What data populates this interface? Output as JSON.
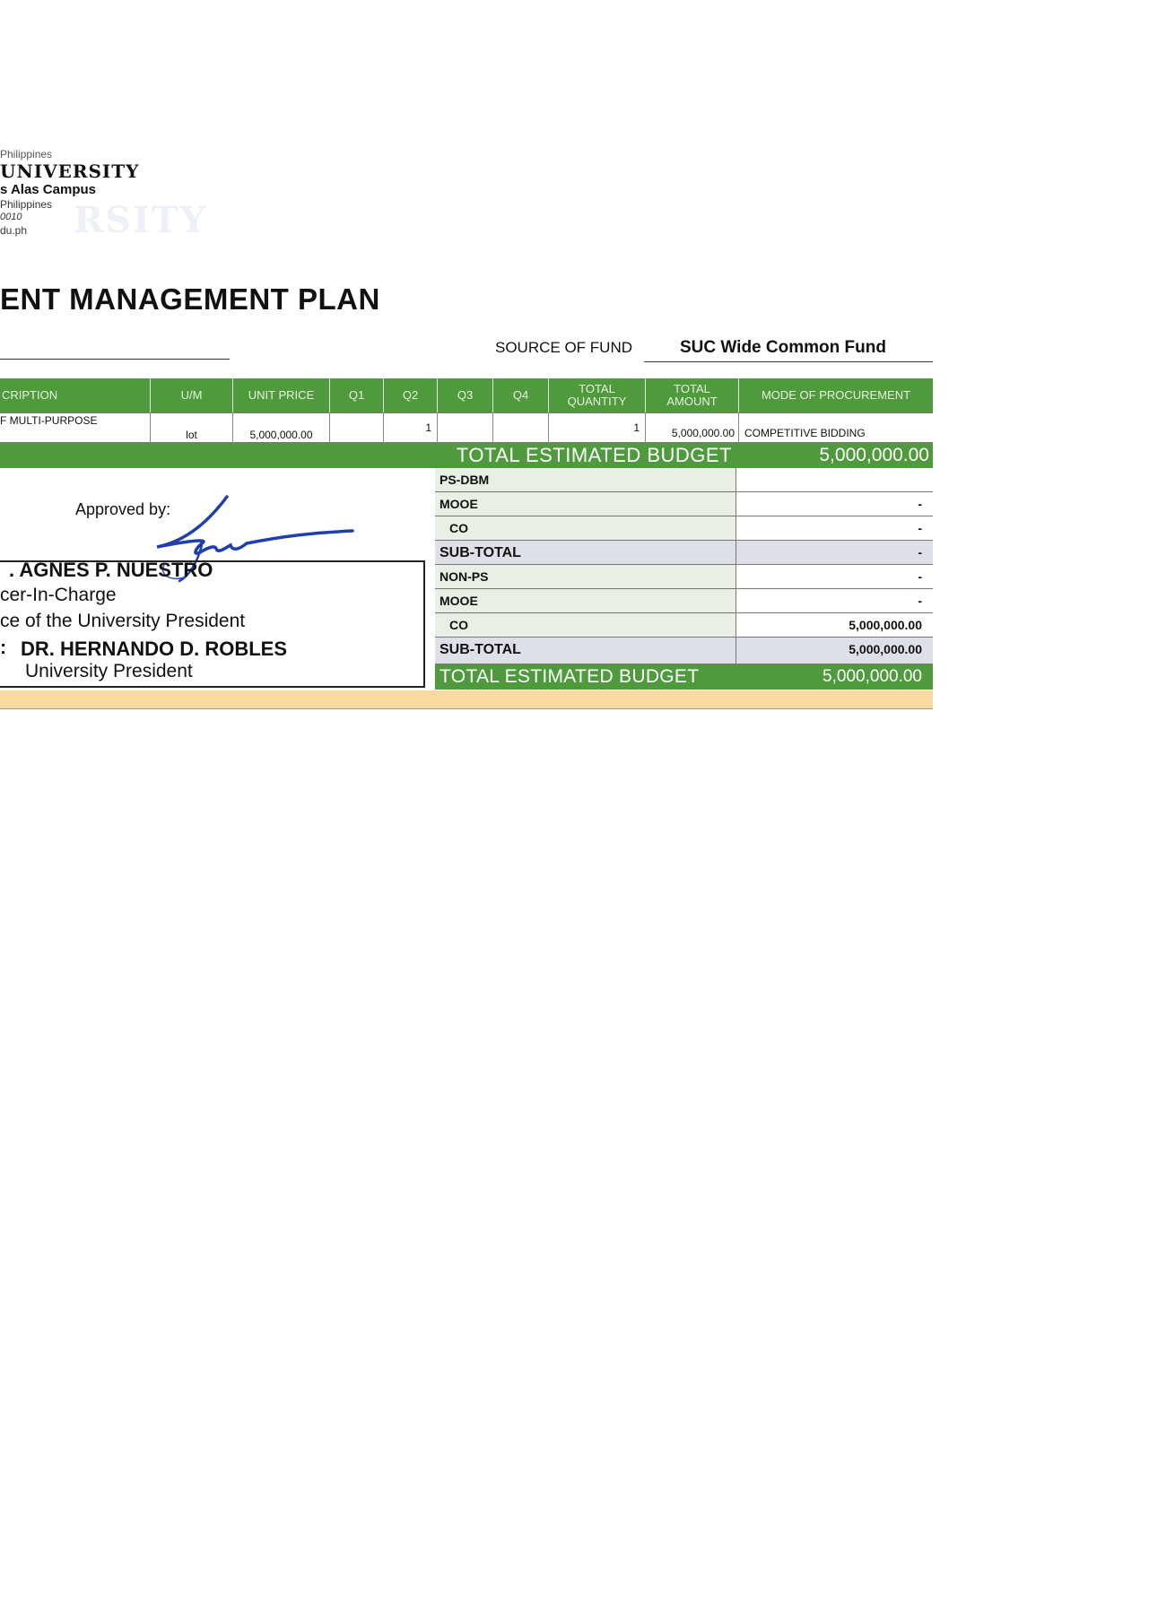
{
  "letterhead": {
    "line1": "Philippines",
    "university": "UNIVERSITY",
    "campus": "s Alas Campus",
    "country": "Philippines",
    "zip": "0010",
    "web": "du.ph",
    "watermark": "RSITY"
  },
  "title": "ENT MANAGEMENT PLAN",
  "source_of_fund": {
    "label": "SOURCE OF FUND",
    "value": "SUC Wide Common Fund"
  },
  "table": {
    "headers": {
      "description": "CRIPTION",
      "um": "U/M",
      "unit_price": "UNIT PRICE",
      "q1": "Q1",
      "q2": "Q2",
      "q3": "Q3",
      "q4": "Q4",
      "total_quantity": "TOTAL QUANTITY",
      "total_amount": "TOTAL AMOUNT",
      "mode": "MODE OF PROCUREMENT"
    },
    "row": {
      "description": "F MULTI-PURPOSE",
      "um": "lot",
      "unit_price": "5,000,000.00",
      "q1": "",
      "q2": "1",
      "q3": "",
      "q4": "",
      "total_quantity": "1",
      "total_amount": "5,000,000.00",
      "mode": "COMPETITIVE BIDDING"
    },
    "total_label": "TOTAL ESTIMATED BUDGET",
    "total_value": "5,000,000.00"
  },
  "summary": {
    "ps_dbm": {
      "label": "PS-DBM",
      "value": ""
    },
    "mooe1": {
      "label": "MOOE",
      "value": "-"
    },
    "co1": {
      "label": "CO",
      "value": "-"
    },
    "subtotal1": {
      "label": "SUB-TOTAL",
      "value": "-"
    },
    "non_ps": {
      "label": "NON-PS",
      "value": "-"
    },
    "mooe2": {
      "label": "MOOE",
      "value": "-"
    },
    "co2": {
      "label": "CO",
      "value": "5,000,000.00"
    },
    "subtotal2": {
      "label": "SUB-TOTAL",
      "value": "5,000,000.00"
    },
    "total_label": "TOTAL ESTIMATED BUDGET",
    "total_value": "5,000,000.00"
  },
  "signatory": {
    "approved_by": "Approved by:",
    "name": ". AGNES P. NUESTRO",
    "role": "cer-In-Charge",
    "office": "ce of the University President",
    "for_prefix": ":",
    "for_name": "DR. HERNANDO D. ROBLES",
    "for_title": "University President"
  },
  "colors": {
    "header_green": "#4e9a3d",
    "band_orange": "#f8d9a0",
    "signature_blue": "#1f3fb0"
  }
}
